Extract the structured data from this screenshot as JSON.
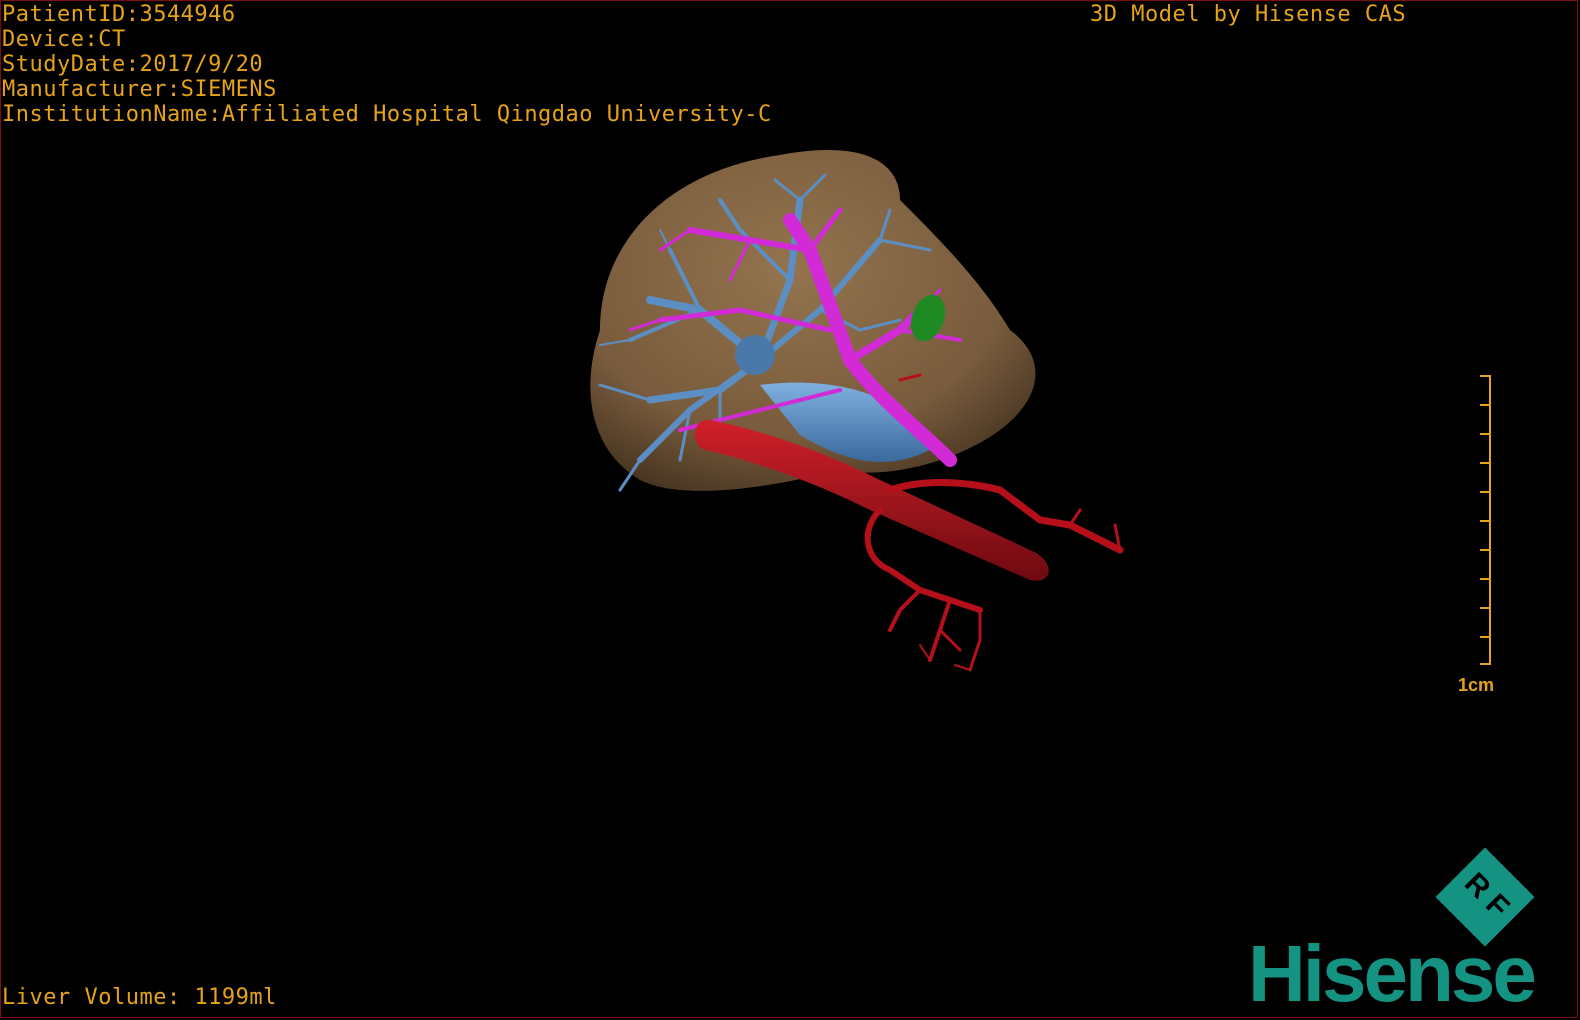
{
  "header": {
    "patient_id": "PatientID:3544946",
    "device": "Device:CT",
    "study_date": "StudyDate:2017/9/20",
    "manufacturer": "Manufacturer:SIEMENS",
    "institution": "InstitutionName:Affiliated Hospital Qingdao University-C"
  },
  "credit": "3D Model by Hisense CAS",
  "footer": {
    "liver_volume": "Liver Volume: 1199ml"
  },
  "scale_bar": {
    "label": "1cm"
  },
  "logo": {
    "mark_text": "R F",
    "brand": "Hisense"
  },
  "colors": {
    "text": "#e6a318",
    "liver": "#8b6a44",
    "portal_vein": "#5b8fc4",
    "hepatic_vein": "#d22ad6",
    "artery": "#b5101a",
    "lesion": "#1f8a22",
    "brand": "#149282"
  },
  "icons": {
    "logo_mark": "rf-diamond-icon"
  }
}
